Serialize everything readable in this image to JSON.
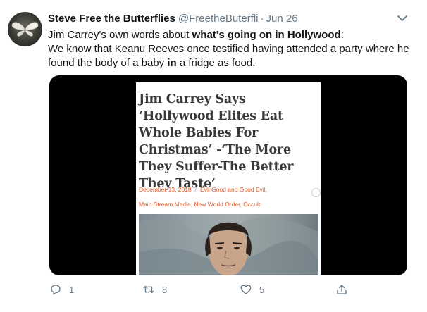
{
  "tweet": {
    "display_name": "Steve Free the Butterflies",
    "handle": "@FreetheButerfli",
    "separator": "·",
    "date": "Jun 26",
    "avatar_icon": "butterfly-avatar",
    "text": {
      "line1_pre": "Jim Carrey's own words about ",
      "line1_bold": "what's going on in Hollywood",
      "line1_post": ":",
      "line2": "We know that Keanu Reeves once testified having attended a party where he",
      "line3_pre": "found the body of a baby ",
      "line3_bold": "in",
      "line3_post": " a fridge as food."
    }
  },
  "media": {
    "article_title": "Jim Carrey Says ‘Hollywood Elites Eat Whole Babies For Christmas’ -‘The More They Suffer-The Better They Taste’",
    "date": "December 13, 2018",
    "separator": "/",
    "category1": "Evil Good and Good Evil,",
    "categories2": "Main Stream Media, New World Order, Occult",
    "accent_color": "#e05a2a"
  },
  "actions": {
    "reply_count": "1",
    "retweet_count": "8",
    "like_count": "5"
  },
  "colors": {
    "text": "#14171a",
    "secondary": "#657786"
  }
}
